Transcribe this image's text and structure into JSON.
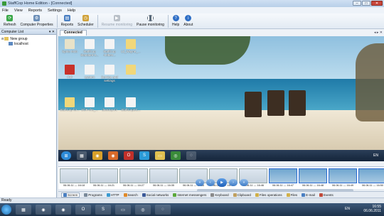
{
  "window": {
    "title": "StaffCop Home Edition - [Connected]",
    "min": "–",
    "max": "□",
    "close": "✕"
  },
  "menu": [
    "File",
    "View",
    "Reports",
    "Settings",
    "Help"
  ],
  "toolbar": {
    "refresh": "Refresh",
    "computer_properties": "Computer Properties",
    "reports": "Reports",
    "scheduler": "Scheduler",
    "resume_monitoring": "Resume monitoring",
    "pause_monitoring": "Pause monitoring",
    "help": "Help",
    "about": "About"
  },
  "left_pane": {
    "title": "Computer List",
    "pin": "▾ ✕",
    "tree": {
      "group": "New group",
      "computer": "localhost"
    }
  },
  "doc_tab": {
    "label": "Connected",
    "nav": "◂ ▸ ✕"
  },
  "desktop_icons": [
    "Sprite Mob",
    "StaffCop Standard e...",
    "StaffCop 4.0bev...",
    "Lil_Wayne_...",
    "Pdf",
    "system",
    "Service and settings",
    "",
    "StaffCop for...",
    "SOR-the_...",
    "desktop.ini",
    "StaffCopSC..."
  ],
  "remote_clock": "EN",
  "thumbnails": [
    "06.06.11 — 16:18",
    "06.06.11 — 16:21",
    "06.06.11 — 16:27",
    "06.06.11 — 16:35",
    "06.06.11 — 16:36",
    "06.06.11 — 16:42",
    "06.06.11 — 16:46",
    "06.06.11 — 16:47",
    "06.06.11 — 16:48",
    "06.06.11 — 16:49",
    "06.06.11 — 16:50"
  ],
  "player": {
    "first": "«",
    "prev": "‹",
    "play": "▶",
    "next": "›",
    "last": "»"
  },
  "bottom_tabs": [
    "Screen",
    "Programs",
    "HTTP",
    "Search",
    "Social networks",
    "Internet messengers",
    "Keyboard",
    "Clipboard",
    "Files operations",
    "Files",
    "E-mail",
    "Events"
  ],
  "status": "Ready",
  "taskbar": {
    "lang": "EN",
    "time": "16:55",
    "date": "06.06.2011"
  }
}
